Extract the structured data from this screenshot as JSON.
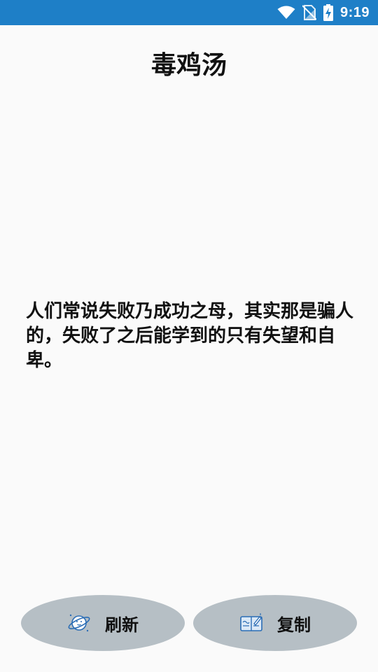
{
  "status_bar": {
    "time": "9:19",
    "icons": [
      "wifi-icon",
      "no-sim-icon",
      "battery-charging-icon"
    ],
    "background": "#1e7fc7"
  },
  "app": {
    "title": "毒鸡汤"
  },
  "quote": {
    "text": "人们常说失败乃成功之母，其实那是骗人的，失败了之后能学到的只有失望和自卑。"
  },
  "actions": {
    "refresh": {
      "label": "刷新",
      "icon": "planet-icon"
    },
    "copy": {
      "label": "复制",
      "icon": "notebook-edit-icon"
    },
    "button_color": "#b6bfc5"
  }
}
